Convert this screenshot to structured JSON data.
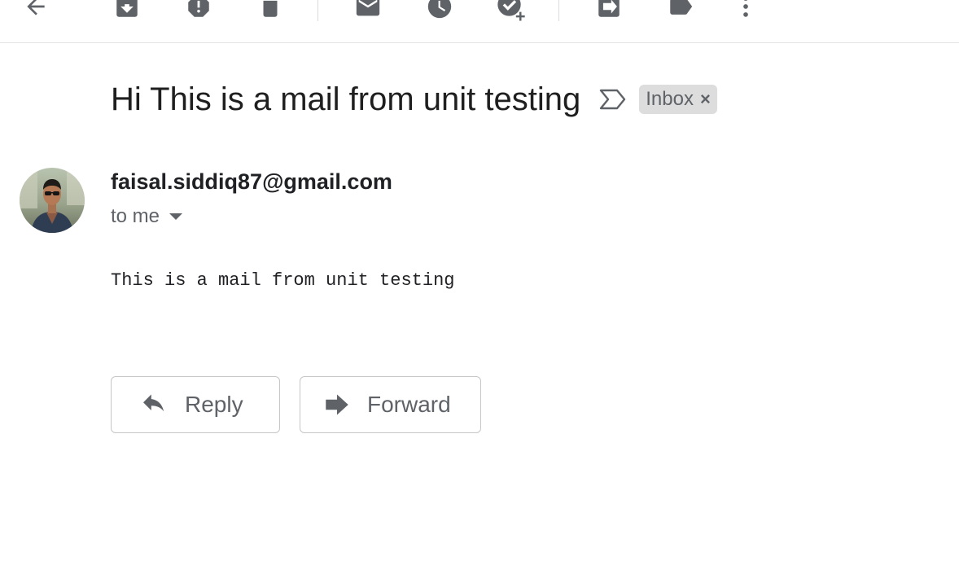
{
  "toolbar": {
    "icons": [
      "back-arrow-icon",
      "archive-icon",
      "report-spam-icon",
      "delete-icon",
      "mark-unread-icon",
      "snooze-icon",
      "add-to-tasks-icon",
      "move-to-icon",
      "labels-icon",
      "more-options-icon"
    ],
    "icon_color": "#5f6368"
  },
  "message": {
    "subject": "Hi This is a mail from unit testing",
    "label": "Inbox",
    "label_remove": "×",
    "sender": "faisal.siddiq87@gmail.com",
    "recipient": "to me",
    "body": "This is a mail from unit testing"
  },
  "actions": {
    "reply_label": "Reply",
    "forward_label": "Forward"
  }
}
